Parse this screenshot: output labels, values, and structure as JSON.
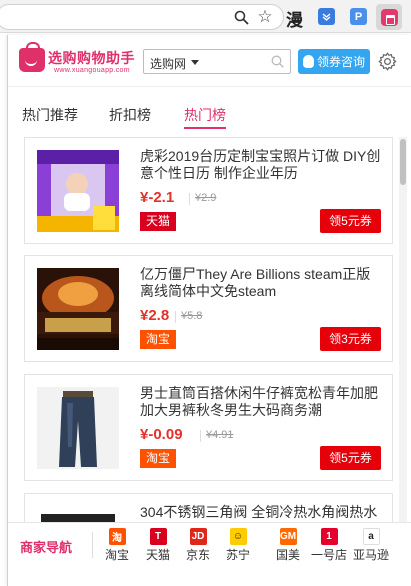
{
  "browser": {
    "ext_man_label": "漫",
    "ext_p_label": "P"
  },
  "header": {
    "logo_title": "选购购物助手",
    "logo_subtitle": "www.xuangouapp.com",
    "search_select": "选购网",
    "consult_label": "领券咨询"
  },
  "tabs": [
    {
      "label": "热门推荐"
    },
    {
      "label": "折扣榜"
    },
    {
      "label": "热门榜"
    }
  ],
  "products": [
    {
      "title": "虎彩2019台历定制宝宝照片订做 DIY创意个性日历 制作企业年历",
      "price": "¥-2.1",
      "old_price": "¥2.9",
      "store": "天猫",
      "store_type": "tmall",
      "coupon": "领5元券"
    },
    {
      "title": "亿万僵尸They Are Billions steam正版 离线简体中文免steam",
      "price": "¥2.8",
      "old_price": "¥5.8",
      "store": "淘宝",
      "store_type": "taobao",
      "coupon": "领3元券"
    },
    {
      "title": "男士直筒百搭休闲牛仔裤宽松青年加肥加大男裤秋冬男生大码商务潮",
      "price": "¥-0.09",
      "old_price": "¥4.91",
      "store": "淘宝",
      "store_type": "taobao",
      "coupon": "领5元券"
    },
    {
      "title": "304不锈钢三角阀 全铜冷热水角阀热水",
      "price": "",
      "old_price": "",
      "store": "",
      "store_type": "",
      "coupon": ""
    }
  ],
  "footer": {
    "title": "商家导航",
    "shops": [
      {
        "label": "淘宝",
        "icon": "taobao-icon",
        "color": "#ff5200",
        "glyph": "淘"
      },
      {
        "label": "天猫",
        "icon": "tmall-icon",
        "color": "#d8001e",
        "glyph": "T"
      },
      {
        "label": "京东",
        "icon": "jd-icon",
        "color": "#e1251b",
        "glyph": "JD"
      },
      {
        "label": "苏宁",
        "icon": "suning-icon",
        "color": "#ffcc00",
        "glyph": "☺"
      },
      {
        "label": "国美",
        "icon": "gome-icon",
        "color": "#ff6a00",
        "glyph": "GM"
      },
      {
        "label": "一号店",
        "icon": "yhd-icon",
        "color": "#e4002b",
        "glyph": "1"
      },
      {
        "label": "亚马逊",
        "icon": "amazon-icon",
        "color": "#ffffff",
        "glyph": "a"
      }
    ]
  },
  "colors": {
    "brand": "#e0306a",
    "price": "#e5302b",
    "coupon": "#e5000a",
    "consult": "#34a5f0"
  }
}
